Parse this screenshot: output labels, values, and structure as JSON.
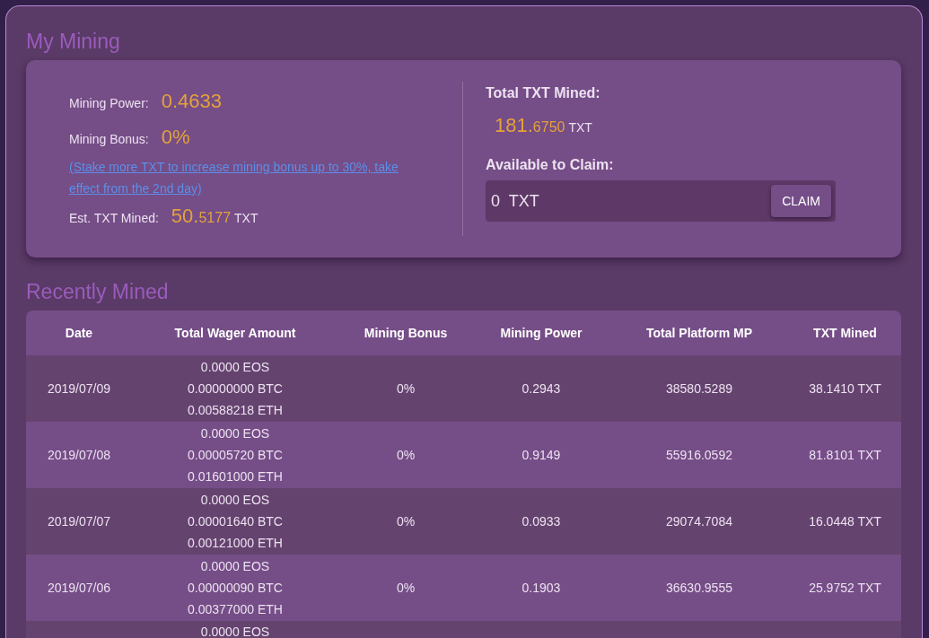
{
  "my_mining": {
    "title": "My Mining",
    "mining_power": {
      "label": "Mining Power:",
      "value": "0.4633"
    },
    "mining_bonus": {
      "label": "Mining Bonus:",
      "value": "0%"
    },
    "bonus_link": "(Stake more TXT to increase mining bonus up to 30%, take effect from the 2nd day)",
    "est_mined": {
      "label": "Est. TXT Mined:",
      "whole": "50.",
      "fraction": "5177",
      "unit": "TXT"
    },
    "total_mined": {
      "label": "Total TXT Mined:",
      "whole": "181.",
      "fraction": "6750",
      "unit": "TXT"
    },
    "available": {
      "label": "Available to Claim:",
      "value": "0",
      "unit": "TXT",
      "button": "CLAIM"
    }
  },
  "recently_mined": {
    "title": "Recently Mined",
    "columns": [
      "Date",
      "Total Wager Amount",
      "Mining Bonus",
      "Mining Power",
      "Total Platform MP",
      "TXT Mined"
    ],
    "rows": [
      {
        "date": "2019/07/09",
        "wager": [
          "0.0000 EOS",
          "0.00000000 BTC",
          "0.00588218 ETH"
        ],
        "bonus": "0%",
        "power": "0.2943",
        "platform_mp": "38580.5289",
        "txt_mined": "38.1410 TXT"
      },
      {
        "date": "2019/07/08",
        "wager": [
          "0.0000 EOS",
          "0.00005720 BTC",
          "0.01601000 ETH"
        ],
        "bonus": "0%",
        "power": "0.9149",
        "platform_mp": "55916.0592",
        "txt_mined": "81.8101 TXT"
      },
      {
        "date": "2019/07/07",
        "wager": [
          "0.0000 EOS",
          "0.00001640 BTC",
          "0.00121000 ETH"
        ],
        "bonus": "0%",
        "power": "0.0933",
        "platform_mp": "29074.7084",
        "txt_mined": "16.0448 TXT"
      },
      {
        "date": "2019/07/06",
        "wager": [
          "0.0000 EOS",
          "0.00000090 BTC",
          "0.00377000 ETH"
        ],
        "bonus": "0%",
        "power": "0.1903",
        "platform_mp": "36630.9555",
        "txt_mined": "25.9752 TXT"
      },
      {
        "wager": [
          "0.0000 EOS"
        ]
      }
    ]
  }
}
